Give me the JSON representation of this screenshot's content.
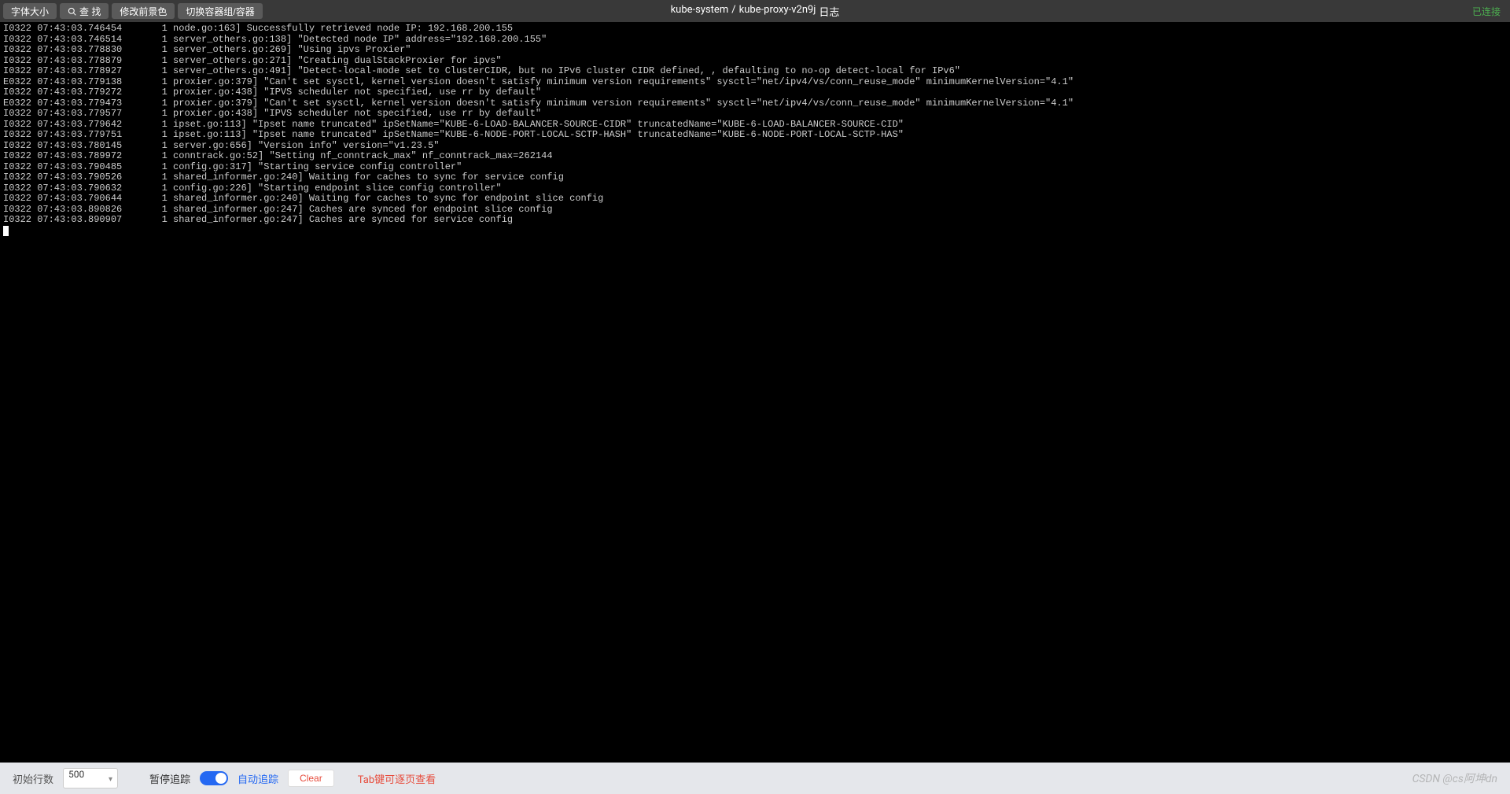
{
  "topbar": {
    "font_size_label": "字体大小",
    "search_label": "查 找",
    "change_fg_label": "修改前景色",
    "switch_container_label": "切换容器组/容器"
  },
  "breadcrumb": {
    "namespace": "kube-system",
    "separator": "/",
    "pod": "kube-proxy-v2n9j",
    "suffix": "日志"
  },
  "status": {
    "connected": "已连接"
  },
  "logs": [
    "I0322 07:43:03.746454       1 node.go:163] Successfully retrieved node IP: 192.168.200.155",
    "I0322 07:43:03.746514       1 server_others.go:138] \"Detected node IP\" address=\"192.168.200.155\"",
    "I0322 07:43:03.778830       1 server_others.go:269] \"Using ipvs Proxier\"",
    "I0322 07:43:03.778879       1 server_others.go:271] \"Creating dualStackProxier for ipvs\"",
    "I0322 07:43:03.778927       1 server_others.go:491] \"Detect-local-mode set to ClusterCIDR, but no IPv6 cluster CIDR defined, , defaulting to no-op detect-local for IPv6\"",
    "E0322 07:43:03.779138       1 proxier.go:379] \"Can't set sysctl, kernel version doesn't satisfy minimum version requirements\" sysctl=\"net/ipv4/vs/conn_reuse_mode\" minimumKernelVersion=\"4.1\"",
    "I0322 07:43:03.779272       1 proxier.go:438] \"IPVS scheduler not specified, use rr by default\"",
    "E0322 07:43:03.779473       1 proxier.go:379] \"Can't set sysctl, kernel version doesn't satisfy minimum version requirements\" sysctl=\"net/ipv4/vs/conn_reuse_mode\" minimumKernelVersion=\"4.1\"",
    "I0322 07:43:03.779577       1 proxier.go:438] \"IPVS scheduler not specified, use rr by default\"",
    "I0322 07:43:03.779642       1 ipset.go:113] \"Ipset name truncated\" ipSetName=\"KUBE-6-LOAD-BALANCER-SOURCE-CIDR\" truncatedName=\"KUBE-6-LOAD-BALANCER-SOURCE-CID\"",
    "I0322 07:43:03.779751       1 ipset.go:113] \"Ipset name truncated\" ipSetName=\"KUBE-6-NODE-PORT-LOCAL-SCTP-HASH\" truncatedName=\"KUBE-6-NODE-PORT-LOCAL-SCTP-HAS\"",
    "I0322 07:43:03.780145       1 server.go:656] \"Version info\" version=\"v1.23.5\"",
    "I0322 07:43:03.789972       1 conntrack.go:52] \"Setting nf_conntrack_max\" nf_conntrack_max=262144",
    "I0322 07:43:03.790485       1 config.go:317] \"Starting service config controller\"",
    "I0322 07:43:03.790526       1 shared_informer.go:240] Waiting for caches to sync for service config",
    "I0322 07:43:03.790632       1 config.go:226] \"Starting endpoint slice config controller\"",
    "I0322 07:43:03.790644       1 shared_informer.go:240] Waiting for caches to sync for endpoint slice config",
    "I0322 07:43:03.890826       1 shared_informer.go:247] Caches are synced for endpoint slice config",
    "I0322 07:43:03.890907       1 shared_informer.go:247] Caches are synced for service config"
  ],
  "bottom": {
    "initial_lines_label": "初始行数",
    "initial_lines_value": "500",
    "pause_track_label": "暂停追踪",
    "auto_track_label": "自动追踪",
    "clear_label": "Clear",
    "tab_hint": "Tab键可逐页查看"
  },
  "watermark": "CSDN @cs阿坤dn"
}
